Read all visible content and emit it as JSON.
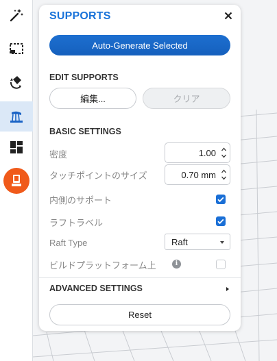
{
  "toolbar": {
    "tools": [
      {
        "name": "magic-wand-icon"
      },
      {
        "name": "select-region-icon"
      },
      {
        "name": "orient-icon"
      },
      {
        "name": "supports-icon",
        "active": true
      },
      {
        "name": "layout-icon"
      },
      {
        "name": "print-icon"
      }
    ],
    "accent_color": "#f05a1a"
  },
  "panel": {
    "title": "SUPPORTS",
    "close_icon": "close-icon",
    "auto_generate_label": "Auto-Generate Selected",
    "edit_section": {
      "heading": "EDIT SUPPORTS",
      "edit_label": "編集...",
      "clear_label": "クリア"
    },
    "basic_section": {
      "heading": "BASIC SETTINGS",
      "density": {
        "label": "密度",
        "value": "1.00"
      },
      "touchpoint": {
        "label": "タッチポイントのサイズ",
        "value": "0.70 mm"
      },
      "internal": {
        "label": "内側のサポート",
        "checked": true
      },
      "raft_label": {
        "label": "ラフトラベル",
        "checked": true
      },
      "raft_type": {
        "label": "Raft Type",
        "value": "Raft"
      },
      "on_platform": {
        "label": "ビルドプラットフォーム上",
        "checked": false
      }
    },
    "advanced_heading": "ADVANCED SETTINGS",
    "reset_label": "Reset",
    "primary_color": "#1565c0"
  }
}
